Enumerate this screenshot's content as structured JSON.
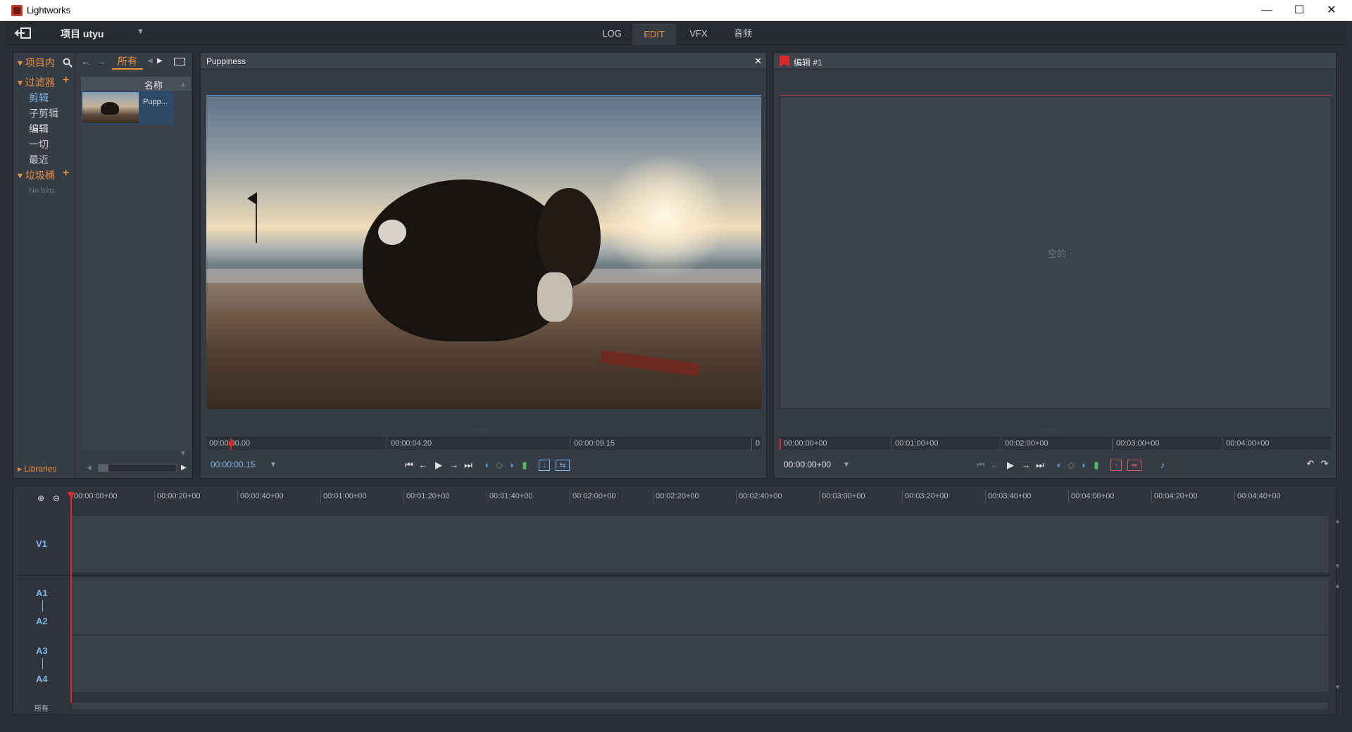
{
  "window": {
    "title": "Lightworks",
    "minimize": "—",
    "maximize": "☐",
    "close": "✕"
  },
  "menubar": {
    "project_label": "项目 utyu",
    "project_dropdown": "▼",
    "tabs": [
      {
        "label": "LOG",
        "active": false
      },
      {
        "label": "EDIT",
        "active": true
      },
      {
        "label": "VFX",
        "active": false
      },
      {
        "label": "音频",
        "active": false
      }
    ]
  },
  "project_panel": {
    "title": "项目内",
    "nav_tab": "所有",
    "filters_label": "过滤器",
    "filters": [
      "剪辑",
      "子剪辑",
      "编辑",
      "一切",
      "最近"
    ],
    "bins_label": "垃圾桶",
    "no_bins": "No bins",
    "libraries": "Libraries",
    "column_header": "名称",
    "clip_name": "Pupp..."
  },
  "source_viewer": {
    "title": "Puppiness",
    "close": "✕",
    "ruler": [
      "00:00:00.00",
      "00:00:04.20",
      "00:00:09.15",
      "0"
    ],
    "timecode": "00:00:00.15",
    "timecode_dd": "▼"
  },
  "record_viewer": {
    "title": "编辑 #1",
    "empty_text": "空的",
    "ruler": [
      "00:00:00+00",
      "00:01:00+00",
      "00:02:00+00",
      "00:03:00+00",
      "00:04:00+00"
    ],
    "timecode": "00:00:00+00",
    "timecode_dd": "▼"
  },
  "timeline": {
    "ruler": [
      "00:00:00+00",
      "00:00:20+00",
      "00:00:40+00",
      "00:01:00+00",
      "00:01:20+00",
      "00:01:40+00",
      "00:02:00+00",
      "00:02:20+00",
      "00:02:40+00",
      "00:03:00+00",
      "00:03:20+00",
      "00:03:40+00",
      "00:04:00+00",
      "00:04:20+00",
      "00:04:40+00"
    ],
    "tracks": [
      "V1",
      "A1",
      "A2",
      "A3",
      "A4"
    ],
    "all_label": "所有"
  },
  "colors": {
    "accent": "#e89040",
    "timecode": "#7fb7e8",
    "playhead": "#d92a2a"
  }
}
